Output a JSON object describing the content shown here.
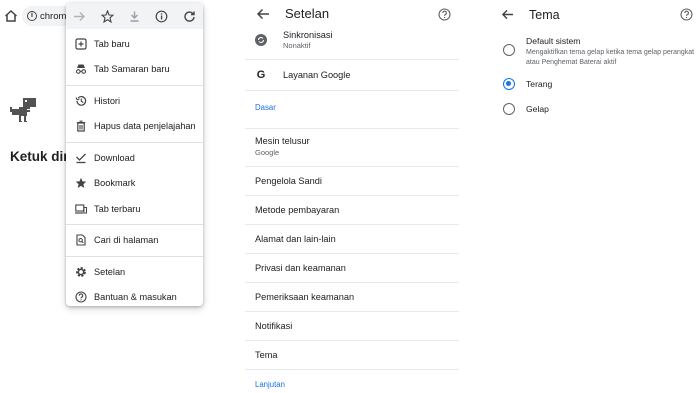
{
  "browser": {
    "omnibox_text": "chrome",
    "dino_message": "Ketuk dino"
  },
  "menu": {
    "items": [
      {
        "label": "Tab baru",
        "icon": "new-tab-icon"
      },
      {
        "label": "Tab Samaran baru",
        "icon": "incognito-icon"
      },
      {
        "label": "Histori",
        "icon": "history-icon"
      },
      {
        "label": "Hapus data penjelajahan",
        "icon": "trash-icon"
      },
      {
        "label": "Download",
        "icon": "download-check-icon"
      },
      {
        "label": "Bookmark",
        "icon": "star-icon"
      },
      {
        "label": "Tab terbaru",
        "icon": "devices-icon"
      },
      {
        "label": "Cari di halaman",
        "icon": "find-in-page-icon"
      },
      {
        "label": "Setelan",
        "icon": "gear-icon"
      },
      {
        "label": "Bantuan & masukan",
        "icon": "help-icon"
      }
    ]
  },
  "settings": {
    "title": "Setelan",
    "sync": {
      "label": "Sinkronisasi",
      "status": "Nonaktif"
    },
    "google_services": "Layanan Google",
    "section_basic": "Dasar",
    "search_engine": {
      "label": "Mesin telusur",
      "value": "Google"
    },
    "items": [
      "Pengelola Sandi",
      "Metode pembayaran",
      "Alamat dan lain-lain",
      "Privasi dan keamanan",
      "Pemeriksaan keamanan",
      "Notifikasi",
      "Tema"
    ],
    "section_advanced": "Lanjutan"
  },
  "theme": {
    "title": "Tema",
    "options": [
      {
        "label": "Default sistem",
        "desc": "Mengaktifkan tema gelap ketika tema gelap perangkat atau Penghemat Baterai aktif",
        "selected": false
      },
      {
        "label": "Terang",
        "desc": "",
        "selected": true
      },
      {
        "label": "Gelap",
        "desc": "",
        "selected": false
      }
    ]
  },
  "colors": {
    "accent": "#1a73e8",
    "text": "#202124",
    "secondary": "#5f6368",
    "divider": "#e8eaed"
  }
}
